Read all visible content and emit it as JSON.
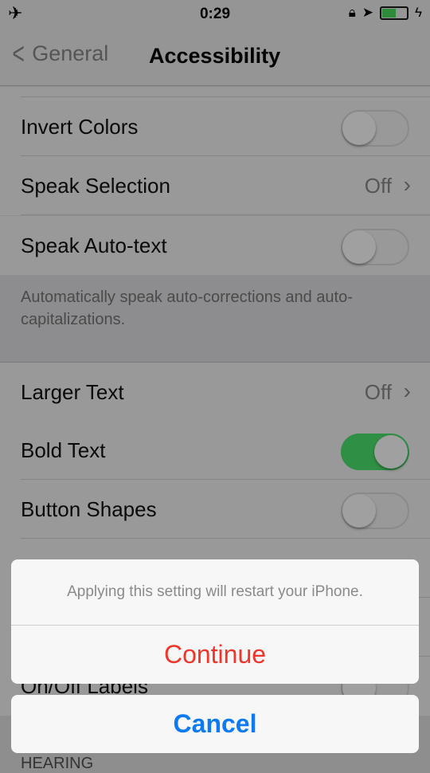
{
  "status_bar": {
    "time": "0:29",
    "airplane_icon": "airplane-icon",
    "battery_level": 0.55
  },
  "nav": {
    "back_label": "General",
    "title": "Accessibility"
  },
  "rows": [
    {
      "label": "Invert Colors",
      "switch_on": false
    },
    {
      "label": "Speak Selection",
      "value": "Off"
    },
    {
      "label": "Speak Auto-text",
      "switch_on": false
    },
    {
      "label": "Larger Text",
      "value": "Off"
    },
    {
      "label": "Bold Text",
      "switch_on": true
    },
    {
      "label": "Button Shapes",
      "switch_on": false
    },
    {
      "label": "On/Off Labels",
      "switch_on": false
    }
  ],
  "footer_text": "Automatically speak auto-corrections and auto-capitalizations.",
  "section_header": "HEARING",
  "action_sheet": {
    "message": "Applying this setting will restart your iPhone.",
    "continue_label": "Continue",
    "cancel_label": "Cancel"
  },
  "colors": {
    "switch_on": "#4cd964",
    "destructive": "#ff3b30",
    "tint": "#007aff"
  }
}
